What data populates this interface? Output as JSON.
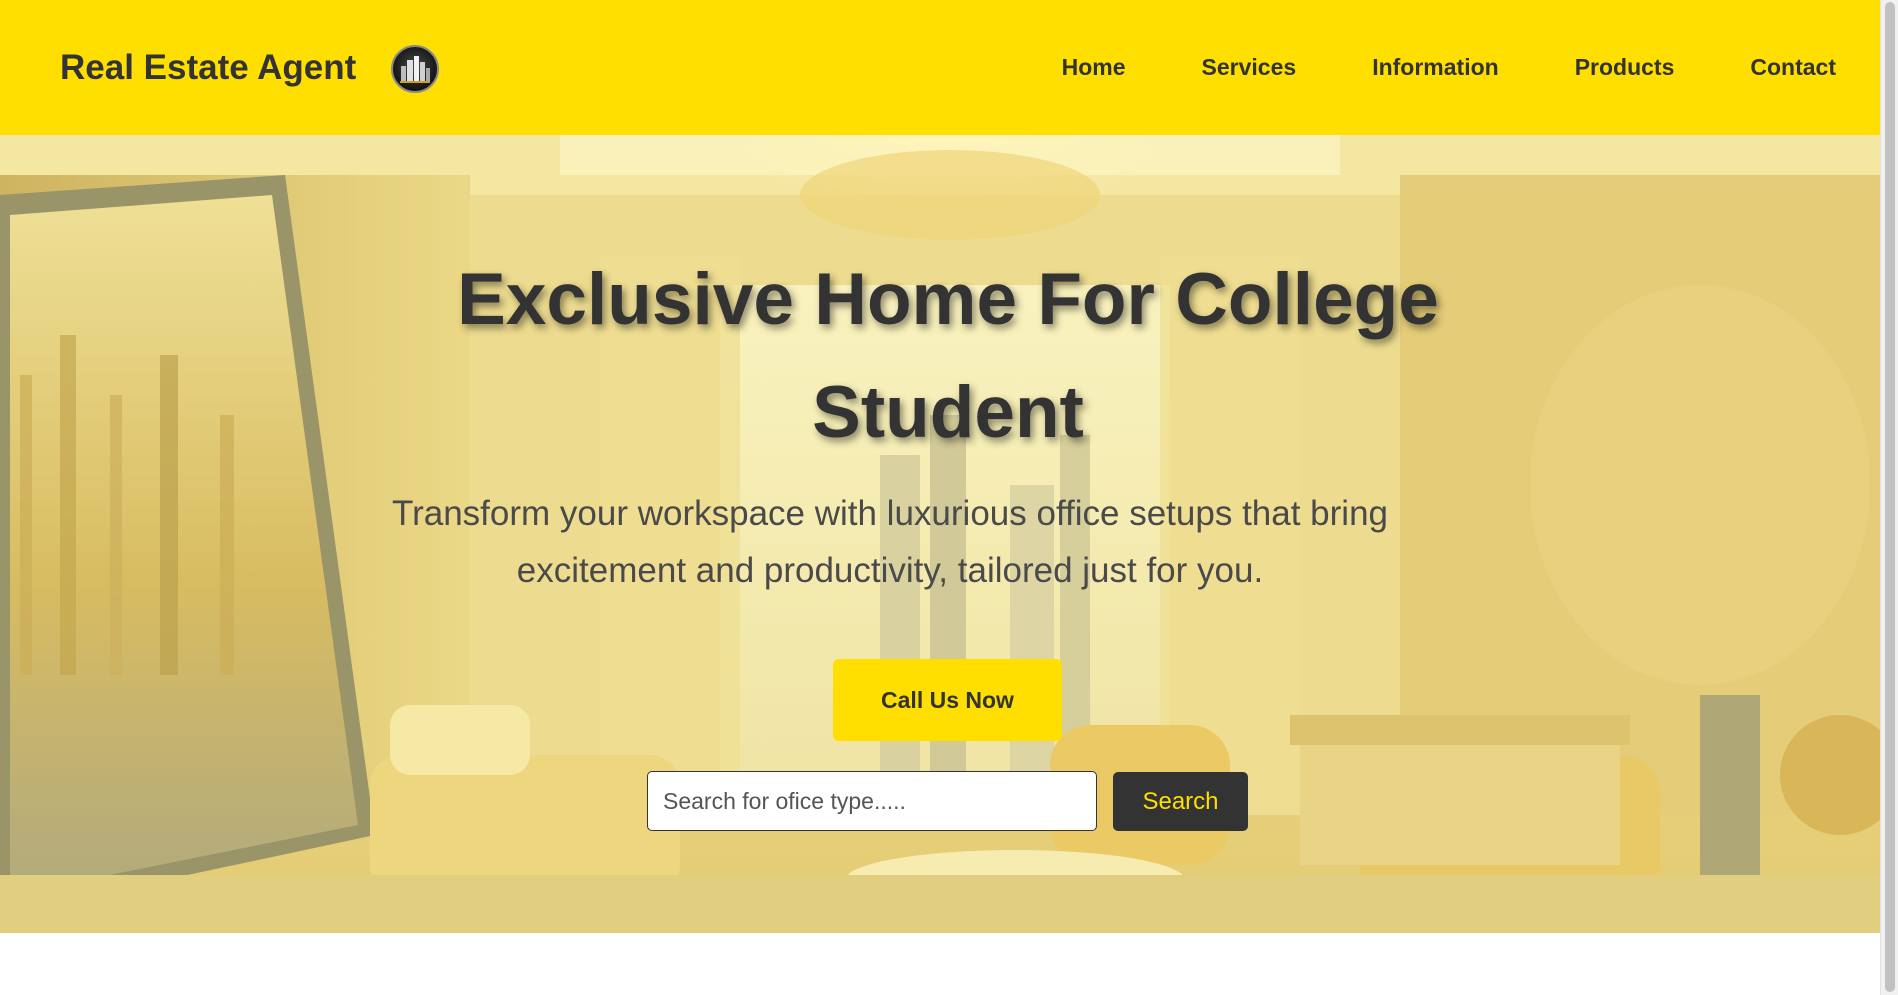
{
  "header": {
    "brand_title": "Real Estate Agent",
    "logo_icon": "building-emblem-icon",
    "nav": [
      {
        "label": "Home"
      },
      {
        "label": "Services"
      },
      {
        "label": "Information"
      },
      {
        "label": "Products"
      },
      {
        "label": "Contact"
      }
    ]
  },
  "hero": {
    "title": "Exclusive Home For College Student",
    "subtitle": "Transform your workspace with luxurious office setups that bring excitement and productivity, tailored just for you.",
    "cta_label": "Call Us Now",
    "search": {
      "placeholder": "Search for ofice type.....",
      "value": "",
      "button_label": "Search"
    }
  },
  "colors": {
    "accent": "#ffdf00",
    "text_dark": "#333333",
    "search_button_bg": "#333333",
    "search_button_text": "#ffdf00"
  }
}
